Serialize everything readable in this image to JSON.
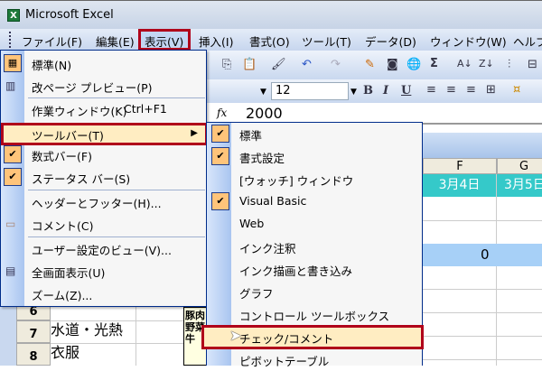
{
  "window": {
    "title": "Microsoft Excel",
    "app_icon": "excel-icon"
  },
  "menubar": {
    "items": [
      "ファイル(F)",
      "編集(E)",
      "表示(V)",
      "挿入(I)",
      "書式(O)",
      "ツール(T)",
      "データ(D)",
      "ウィンドウ(W)",
      "ヘルプ"
    ]
  },
  "toolbar": {
    "font_size": "12",
    "bold": "B",
    "italic": "I",
    "underline": "U",
    "sum": "Σ"
  },
  "formula_bar": {
    "fx": "fx",
    "value": "2000"
  },
  "sheet": {
    "columns": [
      "F",
      "G"
    ],
    "dates": [
      "3月4日",
      "3月5日"
    ],
    "total_value": "0",
    "rows": [
      {
        "num": "6",
        "label": ""
      },
      {
        "num": "7",
        "label": "水道・光熱"
      },
      {
        "num": "8",
        "label": "衣服"
      }
    ],
    "comment": [
      "豚肉",
      "野菜",
      "牛"
    ]
  },
  "view_menu": {
    "items": [
      {
        "label": "標準(N)",
        "icon": "normal-view-icon"
      },
      {
        "label": "改ページ プレビュー(P)",
        "icon": "page-break-icon"
      },
      {
        "label": "作業ウィンドウ(K)",
        "shortcut": "Ctrl+F1"
      },
      {
        "label": "ツールバー(T)",
        "highlighted": true
      },
      {
        "label": "数式バー(F)",
        "checked": true
      },
      {
        "label": "ステータス バー(S)",
        "checked": true
      },
      {
        "label": "ヘッダーとフッター(H)..."
      },
      {
        "label": "コメント(C)",
        "icon": "comment-icon"
      },
      {
        "label": "ユーザー設定のビュー(V)..."
      },
      {
        "label": "全画面表示(U)",
        "icon": "full-screen-icon"
      },
      {
        "label": "ズーム(Z)..."
      }
    ]
  },
  "toolbar_submenu": {
    "items": [
      {
        "label": "標準",
        "checked": true
      },
      {
        "label": "書式設定",
        "checked": true
      },
      {
        "label": "[ウォッチ] ウィンドウ"
      },
      {
        "label": "Visual Basic",
        "checked": true
      },
      {
        "label": "Web"
      },
      {
        "label": "インク注釈"
      },
      {
        "label": "インク描画と書き込み"
      },
      {
        "label": "グラフ"
      },
      {
        "label": "コントロール ツールボックス"
      },
      {
        "label": "チェック/コメント",
        "highlighted": true
      },
      {
        "label": "ピボットテーブル"
      }
    ]
  },
  "colors": {
    "highlight_border": "#b0001a",
    "date_header": "#35c9c9",
    "check_bg": "#ffc47a",
    "hover_bg": "#ffedc2"
  }
}
